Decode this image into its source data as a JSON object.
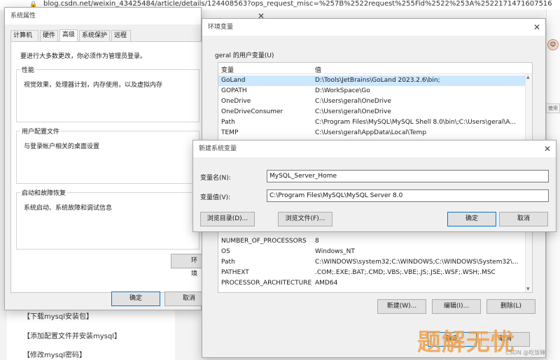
{
  "browser": {
    "url": "blog.csdn.net/weixin_43425484/article/details/124408563?ops_request_misc=%257B%2522request%255Fid%2522%253A%2522171471607516",
    "side_button": "使用"
  },
  "blog_nav": {
    "items": [
      "【下载mysql安装包】",
      "【添加配置文件并安装mysql】",
      "【修改mysql密码】"
    ]
  },
  "system_properties": {
    "title": "系统属性",
    "tabs": [
      "计算机名",
      "硬件",
      "高级",
      "系统保护",
      "远程"
    ],
    "active_tab": "高级",
    "admin_note": "要进行大多数更改，你必须作为管理员登录。",
    "groups": [
      {
        "label": "性能",
        "text": "视觉效果，处理器计划，内存使用，以及虚拟内存"
      },
      {
        "label": "用户配置文件",
        "text": "与登录帐户相关的桌面设置"
      },
      {
        "label": "启动和故障恢复",
        "text": "系统启动、系统故障和调试信息"
      }
    ],
    "env_button": "环境",
    "ok": "确定",
    "cancel": "取消"
  },
  "env_vars": {
    "title": "环境变量",
    "user_section": "geral 的用户变量(U)",
    "col_variable": "变量",
    "col_value": "值",
    "user_rows": [
      {
        "name": "GoLand",
        "value": "D:\\Tools\\JetBrains\\GoLand 2023.2.6\\bin;"
      },
      {
        "name": "GOPATH",
        "value": "D:\\WorkSpace\\Go"
      },
      {
        "name": "OneDrive",
        "value": "C:\\Users\\geral\\OneDrive"
      },
      {
        "name": "OneDriveConsumer",
        "value": "C:\\Users\\geral\\OneDrive"
      },
      {
        "name": "Path",
        "value": "C:\\Program Files\\MySQL\\MySQL Shell 8.0\\bin\\;C:\\Users\\geral\\A..."
      },
      {
        "name": "TEMP",
        "value": "C:\\Users\\geral\\AppData\\Local\\Temp"
      }
    ],
    "system_rows": [
      {
        "name": "NUMBER_OF_PROCESSORS",
        "value": "8"
      },
      {
        "name": "OS",
        "value": "Windows_NT"
      },
      {
        "name": "Path",
        "value": "C:\\WINDOWS\\system32;C:\\WINDOWS;C:\\WINDOWS\\System32\\..."
      },
      {
        "name": "PATHEXT",
        "value": ".COM;.EXE;.BAT;.CMD;.VBS;.VBE;.JS;.JSE;.WSF;.WSH;.MSC"
      },
      {
        "name": "PROCESSOR_ARCHITECTURE",
        "value": "AMD64"
      }
    ],
    "new_button": "新建(W)...",
    "edit_button": "编辑(I)...",
    "delete_button": "删除(L)",
    "ok": "确定",
    "cancel": "取消"
  },
  "new_sys_var": {
    "title": "新建系统变量",
    "name_label": "变量名(N):",
    "name_value": "MySQL_Server_Home",
    "value_label": "变量值(V):",
    "value_value": "C:\\Program Files\\MySQL\\MySQL Server 8.0",
    "browse_dir": "浏览目录(D)...",
    "browse_file": "浏览文件(F)...",
    "ok": "确定",
    "cancel": "取消"
  },
  "watermark": {
    "text": "题解无忧",
    "csdn": "CSDN @吃饭睡"
  }
}
